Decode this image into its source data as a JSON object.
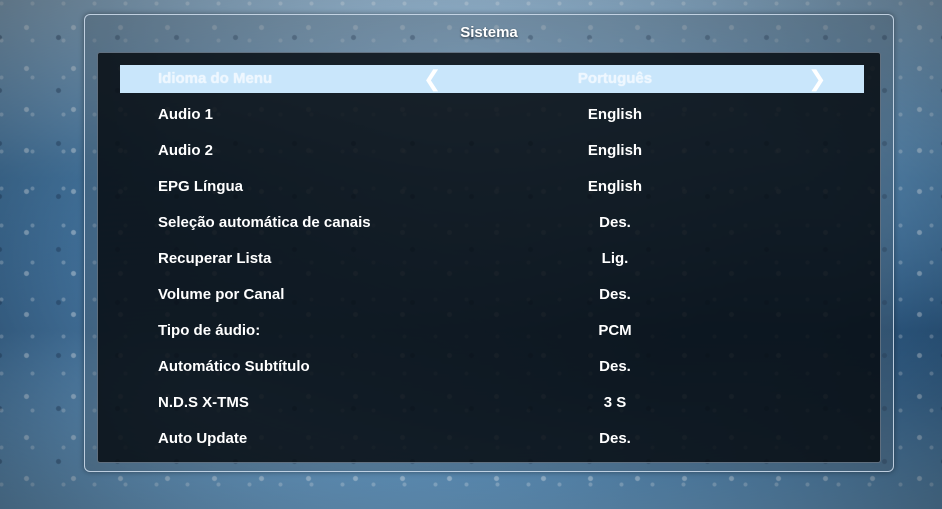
{
  "dialog": {
    "title": "Sistema"
  },
  "settings": [
    {
      "label": "Idioma do Menu",
      "value": "Português",
      "selected": true
    },
    {
      "label": "Audio 1",
      "value": "English"
    },
    {
      "label": "Audio 2",
      "value": "English"
    },
    {
      "label": "EPG Língua",
      "value": "English"
    },
    {
      "label": "Seleção automática de canais",
      "value": "Des."
    },
    {
      "label": "Recuperar Lista",
      "value": "Lig."
    },
    {
      "label": "Volume por Canal",
      "value": "Des."
    },
    {
      "label": "Tipo de áudio:",
      "value": "PCM"
    },
    {
      "label": "Automático Subtítulo",
      "value": "Des."
    },
    {
      "label": "N.D.S X-TMS",
      "value": "3 S"
    },
    {
      "label": "Auto Update",
      "value": "Des."
    }
  ],
  "icons": {
    "prev": "chevron-left-icon",
    "next": "chevron-right-icon"
  },
  "colors": {
    "highlight": "#c9e6fb",
    "panel": "#04080e",
    "text": "#ffffff"
  }
}
